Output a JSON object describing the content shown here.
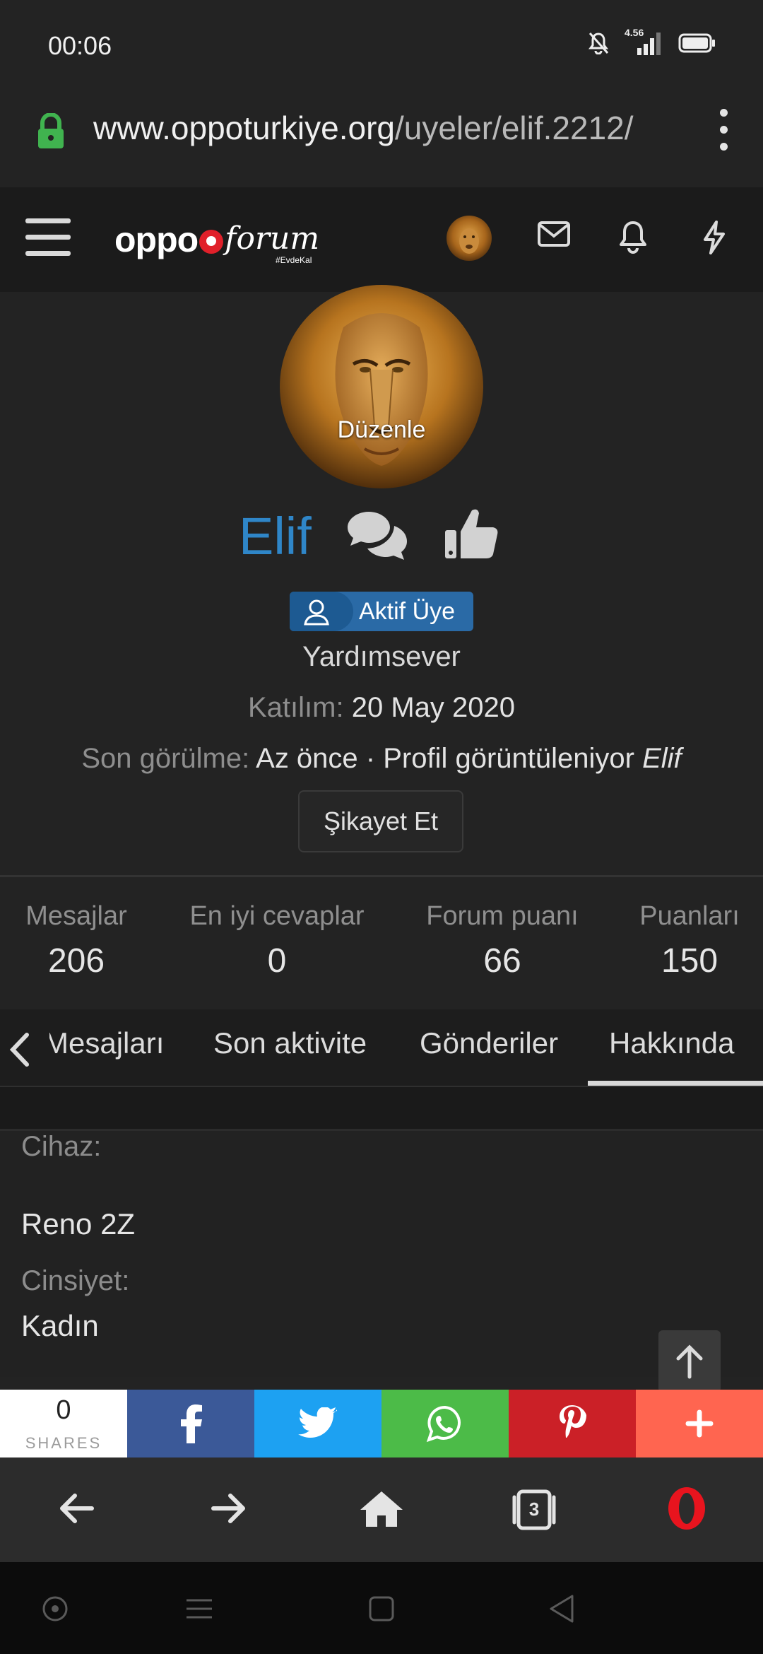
{
  "status_bar": {
    "time": "00:06",
    "network": "4.56"
  },
  "browser": {
    "url_domain": "www.oppoturkiye.org",
    "url_path": "/uyeler/elif.2212/"
  },
  "site_header": {
    "logo_main": "oppo",
    "logo_sub": "forum",
    "logo_tag": "#EvdeKal"
  },
  "profile": {
    "edit_label": "Düzenle",
    "username": "Elif",
    "badge": "Aktif Üye",
    "user_title": "Yardımsever",
    "joined_label": "Katılım:",
    "joined_value": "20 May 2020",
    "last_seen_label": "Son görülme:",
    "last_seen_value": "Az önce · Profil görüntüleniyor",
    "last_seen_name": "Elif",
    "report_button": "Şikayet Et"
  },
  "stats": [
    {
      "label": "Mesajlar",
      "value": "206"
    },
    {
      "label": "En iyi cevaplar",
      "value": "0"
    },
    {
      "label": "Forum puanı",
      "value": "66"
    },
    {
      "label": "Puanları",
      "value": "150"
    }
  ],
  "tabs": [
    {
      "label": "Mesajları"
    },
    {
      "label": "Son aktivite"
    },
    {
      "label": "Gönderiler"
    },
    {
      "label": "Hakkında",
      "active": true
    }
  ],
  "about": {
    "device_label": "Cihaz:",
    "device_value": "Reno 2Z",
    "gender_label": "Cinsiyet:",
    "gender_value": "Kadın"
  },
  "share_bar": {
    "count": "0",
    "count_label": "SHARES",
    "buttons": [
      {
        "name": "facebook",
        "color": "#3b5998"
      },
      {
        "name": "twitter",
        "color": "#1da1f2"
      },
      {
        "name": "whatsapp",
        "color": "#4cbb48"
      },
      {
        "name": "pinterest",
        "color": "#cb2027"
      },
      {
        "name": "more",
        "color": "#ff6550"
      }
    ]
  },
  "browser_nav": {
    "tab_count": "3"
  },
  "colors": {
    "accent": "#2f86c8",
    "badge": "#2a6aa6"
  }
}
